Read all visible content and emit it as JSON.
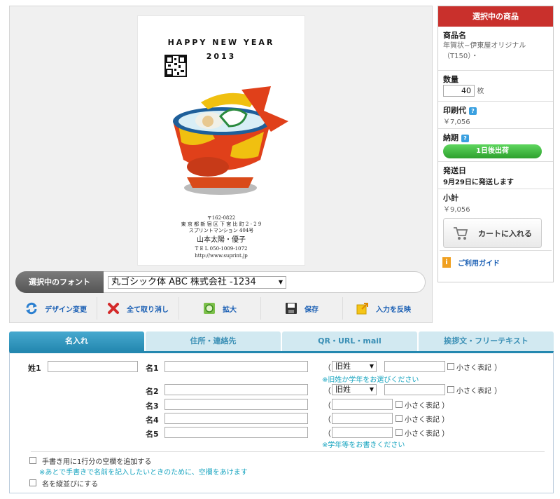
{
  "card": {
    "greeting": "HAPPY NEW YEAR",
    "year": "2013",
    "address_lines": [
      "〒162-0822",
      "東 京 都 新 宿 区 下 宮 比 町 2 - 2 9",
      "スプリントマンション 404号"
    ],
    "names": "山本太陽・優子",
    "tel": "T E L  050-1009-1072",
    "url": "http://www.suprint.jp"
  },
  "font_bar": {
    "label": "選択中のフォント",
    "selected_font": "丸ゴシック体 ABC 株式会社 -1234"
  },
  "toolbar": [
    {
      "label": "デザイン変更",
      "icon": "refresh-icon"
    },
    {
      "label": "全て取り消し",
      "icon": "close-icon"
    },
    {
      "label": "拡大",
      "icon": "zoom-icon"
    },
    {
      "label": "保存",
      "icon": "save-icon"
    },
    {
      "label": "入力を反映",
      "icon": "apply-icon"
    }
  ],
  "sidebar": {
    "header": "選択中の商品",
    "product_label": "商品名",
    "product_name": "年賀状−伊東屋オリジナル（T150）・",
    "quantity_label": "数量",
    "quantity": "40",
    "quantity_unit": "枚",
    "print_cost_label": "印刷代",
    "print_cost": "￥7,056",
    "delivery_label": "納期",
    "delivery_option": "1日後出荷",
    "ship_date_label": "発送日",
    "ship_date": "9月29日に発送します",
    "subtotal_label": "小計",
    "subtotal": "￥9,056",
    "cart_button": "カートに入れる",
    "guide_link": "ご利用ガイド"
  },
  "tabs": [
    "名入れ",
    "住所・連絡先",
    "QR・URL・mail",
    "挨拶文・フリーテキスト"
  ],
  "form": {
    "surname_label": "姓1",
    "name_rows": [
      {
        "label": "名1",
        "select": "旧姓",
        "small": "小さく表記"
      },
      {
        "label": "名2",
        "select": "旧姓",
        "small": "小さく表記"
      },
      {
        "label": "名3",
        "select": "",
        "small": "小さく表記"
      },
      {
        "label": "名4",
        "select": "",
        "small": "小さく表記"
      },
      {
        "label": "名5",
        "select": "",
        "small": "小さく表記"
      }
    ],
    "open_paren": "（",
    "close_paren": "）",
    "note_old_name": "※旧姓か学年をお選びください",
    "note_grade": "※学年等をお書きください",
    "handwrite_option": "手書き用に1行分の空欄を追加する",
    "handwrite_note": "※あとで手書きで名前を記入したいときのために、空欄をあけます",
    "vertical_option": "名を縦並びにする"
  },
  "colors": {
    "accent_red": "#c9302c",
    "tab_blue": "#2488b0",
    "link_blue": "#1a5fb4",
    "note_cyan": "#19a5c0",
    "green": "#2ea02e"
  }
}
